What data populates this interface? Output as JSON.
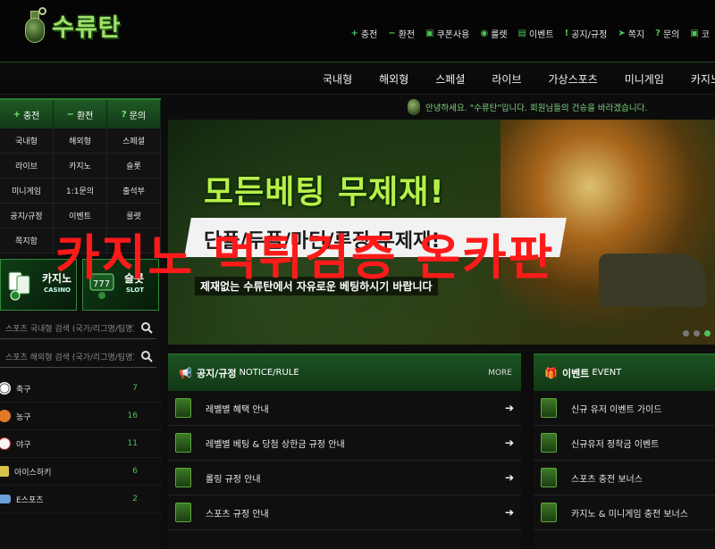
{
  "header": {
    "logo_text": "수류탄",
    "topnav": [
      {
        "icon": "+",
        "label": "충전"
      },
      {
        "icon": "−",
        "label": "환전"
      },
      {
        "icon": "▣",
        "label": "쿠폰사용"
      },
      {
        "icon": "◉",
        "label": "룰렛"
      },
      {
        "icon": "▤",
        "label": "이벤트"
      },
      {
        "icon": "!",
        "label": "공지/규정"
      },
      {
        "icon": "➤",
        "label": "쪽지"
      },
      {
        "icon": "?",
        "label": "문의"
      },
      {
        "icon": "",
        "label": "코"
      }
    ]
  },
  "mainnav": [
    "국내형",
    "해외형",
    "스페셜",
    "라이브",
    "가상스포츠",
    "미니게임",
    "카지노"
  ],
  "sidebar": {
    "quick": [
      {
        "icon": "+",
        "label": "충전"
      },
      {
        "icon": "−",
        "label": "환전"
      },
      {
        "icon": "?",
        "label": "문의"
      }
    ],
    "grid": [
      "국내형",
      "해외형",
      "스페셜",
      "라이브",
      "카지노",
      "슬롯",
      "미니게임",
      "1:1문의",
      "출석부",
      "공지/규정",
      "이벤트",
      "룰렛",
      "쪽지함",
      "",
      ""
    ],
    "banners": [
      {
        "title": "카지노",
        "sub": "CASINO"
      },
      {
        "title": "슬롯",
        "sub": "SLOT"
      }
    ],
    "search1_placeholder": "스포츠 국내형 검색 (국가/리그명/팀명)",
    "search2_placeholder": "스포츠 해외형 검색 (국가/리그명/팀명)",
    "sports": [
      {
        "name": "축구",
        "count": "7",
        "color": "#ffffff"
      },
      {
        "name": "농구",
        "count": "16",
        "color": "#e0792a"
      },
      {
        "name": "야구",
        "count": "11",
        "color": "#f4f4f4"
      },
      {
        "name": "아이스하키",
        "count": "6",
        "color": "#d9c24a"
      },
      {
        "name": "E스포츠",
        "count": "2",
        "color": "#6aa0d8"
      }
    ]
  },
  "welcome": "안녕하세요. \"수류탄\"입니다. 회원님들의 건승을 바라겠습니다.",
  "slider": {
    "headline": "모든베팅 무제재!",
    "subhead": "단폴/두폴/마틴/루징 무제재!",
    "caption": "제재없는 수류탄에서 자유로운 베팅하시기 바랍니다"
  },
  "overlay_text": "카지노 먹튀검증 온카판",
  "notice": {
    "title": "공지/규정",
    "title_en": "NOTICE/RULE",
    "more": "MORE",
    "items": [
      "레벨별 혜택 안내",
      "레벨별 베팅 & 당첨 상한금 규정 안내",
      "롤링 규정 안내",
      "스포츠 규정 안내"
    ]
  },
  "event": {
    "title": "이벤트",
    "title_en": "EVENT",
    "items": [
      "신규 유저 이벤트 가이드",
      "신규유저 정착금 이벤트",
      "스포츠 충전 보너스",
      "카지노 & 미니게임 충전 보너스"
    ]
  },
  "colors": {
    "accent": "#4ec255",
    "overlay": "#ff1a1a",
    "panel_head": "#1c5322"
  }
}
